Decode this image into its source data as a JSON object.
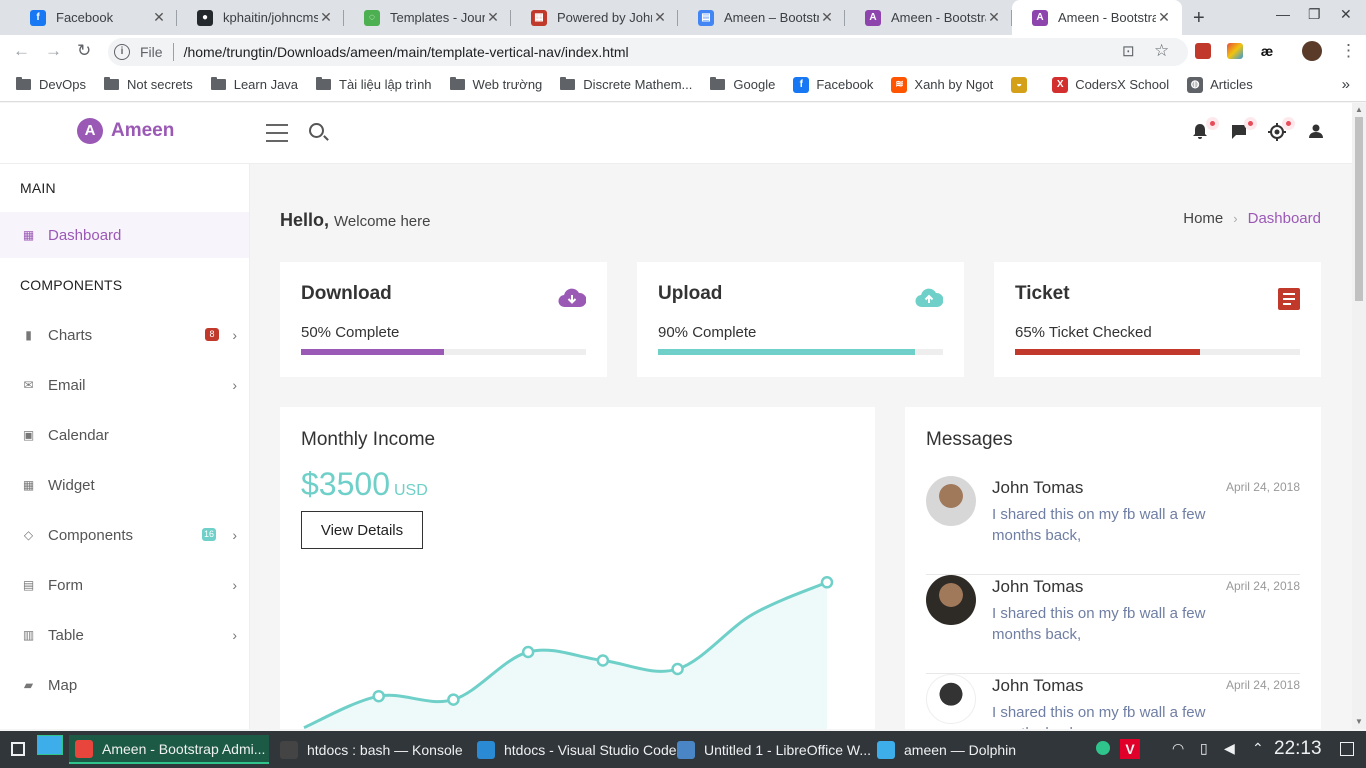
{
  "browser": {
    "tabs": [
      {
        "title": "Facebook",
        "color": "#1877f2",
        "glyph": "f"
      },
      {
        "title": "kphaitin/johncms",
        "color": "#24292e",
        "glyph": "●"
      },
      {
        "title": "Templates - Journ",
        "color": "#4caf50",
        "glyph": "◌"
      },
      {
        "title": "Powered by John",
        "color": "#c0392b",
        "glyph": "▦"
      },
      {
        "title": "Ameen – Bootstr",
        "color": "#4285f4",
        "glyph": "▤"
      },
      {
        "title": "Ameen - Bootstra",
        "color": "#8e44ad",
        "glyph": "A"
      },
      {
        "title": "Ameen - Bootstra",
        "color": "#8e44ad",
        "glyph": "A"
      }
    ],
    "new_tab_label": "+",
    "omnibox": {
      "scheme": "File",
      "url": "/home/trungtin/Downloads/ameen/main/template-vertical-nav/index.html"
    },
    "bookmarks": [
      {
        "label": "DevOps",
        "type": "folder"
      },
      {
        "label": "Not secrets",
        "type": "folder"
      },
      {
        "label": "Learn Java",
        "type": "folder"
      },
      {
        "label": "Tài liệu lập trình",
        "type": "folder"
      },
      {
        "label": "Web trường",
        "type": "folder"
      },
      {
        "label": "Discrete Mathem...",
        "type": "folder"
      },
      {
        "label": "Google",
        "type": "folder"
      },
      {
        "label": "Facebook",
        "type": "site",
        "color": "#1877f2",
        "glyph": "f"
      },
      {
        "label": "Xanh by Ngot",
        "type": "site",
        "color": "#ff5500",
        "glyph": "≋"
      },
      {
        "label": "",
        "type": "site",
        "color": "#d4a017",
        "glyph": "◒"
      },
      {
        "label": "CodersX School",
        "type": "site",
        "color": "#d32f2f",
        "glyph": "X"
      },
      {
        "label": "Articles",
        "type": "site",
        "color": "#5f6368",
        "glyph": "◍"
      }
    ],
    "more_bookmarks": "»"
  },
  "app": {
    "brand": "Ameen",
    "accent": "#9b59b6",
    "sidebar": {
      "section_main": "MAIN",
      "section_components": "COMPONENTS",
      "items": [
        {
          "label": "Dashboard",
          "icon": "dashboard-icon",
          "glyph": "▦",
          "active": true
        },
        {
          "label": "Charts",
          "icon": "bar-chart-icon",
          "glyph": "▮",
          "badge": "8",
          "badge_color": "#c0392b",
          "chevron": "›"
        },
        {
          "label": "Email",
          "icon": "envelope-icon",
          "glyph": "✉",
          "chevron": "›"
        },
        {
          "label": "Calendar",
          "icon": "calendar-icon",
          "glyph": "▣"
        },
        {
          "label": "Widget",
          "icon": "widget-icon",
          "glyph": "▦"
        },
        {
          "label": "Components",
          "icon": "diamond-icon",
          "glyph": "◇",
          "badge": "16",
          "badge_color": "#6ed0c8",
          "chevron": "›"
        },
        {
          "label": "Form",
          "icon": "form-icon",
          "glyph": "▤",
          "chevron": "›"
        },
        {
          "label": "Table",
          "icon": "table-icon",
          "glyph": "▥",
          "chevron": "›"
        },
        {
          "label": "Map",
          "icon": "map-icon",
          "glyph": "▰"
        }
      ]
    },
    "greeting": {
      "bold": "Hello,",
      "rest": "Welcome here"
    },
    "breadcrumb": {
      "home": "Home",
      "separator": "›",
      "current": "Dashboard"
    },
    "stats": [
      {
        "title": "Download",
        "subtitle": "50% Complete",
        "progress": 0.5,
        "color": "#9b59b6",
        "icon": "cloud-download-icon"
      },
      {
        "title": "Upload",
        "subtitle": "90% Complete",
        "progress": 0.9,
        "color": "#6ed0c8",
        "icon": "cloud-upload-icon"
      },
      {
        "title": "Ticket",
        "subtitle": "65% Ticket Checked",
        "progress": 0.65,
        "color": "#c0392b",
        "icon": "ticket-list-icon"
      }
    ],
    "income": {
      "title": "Monthly Income",
      "amount": "$3500",
      "currency": "USD",
      "button": "View Details",
      "color": "#6ed0c8"
    },
    "messages": {
      "title": "Messages",
      "items": [
        {
          "name": "John Tomas",
          "date": "April 24, 2018",
          "text": "I shared this on my fb wall a few months back,"
        },
        {
          "name": "John Tomas",
          "date": "April 24, 2018",
          "text": "I shared this on my fb wall a few months back,"
        },
        {
          "name": "John Tomas",
          "date": "April 24, 2018",
          "text": "I shared this on my fb wall a few months back,"
        }
      ]
    }
  },
  "chart_data": {
    "type": "area",
    "x": [
      1,
      2,
      3,
      4,
      5,
      6,
      7,
      8
    ],
    "values": [
      5.5,
      24,
      22,
      50,
      45,
      40,
      72,
      91
    ],
    "ylim": [
      0,
      100
    ],
    "marker_indices": [
      1,
      2,
      3,
      4,
      5,
      7
    ],
    "color": "#6ed0c8"
  },
  "taskbar": {
    "tasks": [
      {
        "label": "Ameen - Bootstrap Admi...",
        "icon": "chrome-icon",
        "color": "#e8453c",
        "active": true
      },
      {
        "label": "htdocs : bash — Konsole",
        "icon": "terminal-icon",
        "color": "#444"
      },
      {
        "label": "htdocs - Visual Studio Code",
        "icon": "vscode-icon",
        "color": "#2a8ad4"
      },
      {
        "label": "Untitled 1 - LibreOffice W...",
        "icon": "writer-icon",
        "color": "#4a86c6"
      },
      {
        "label": "ameen — Dolphin",
        "icon": "folder-icon",
        "color": "#3daee9"
      }
    ],
    "clock": "22:13"
  }
}
